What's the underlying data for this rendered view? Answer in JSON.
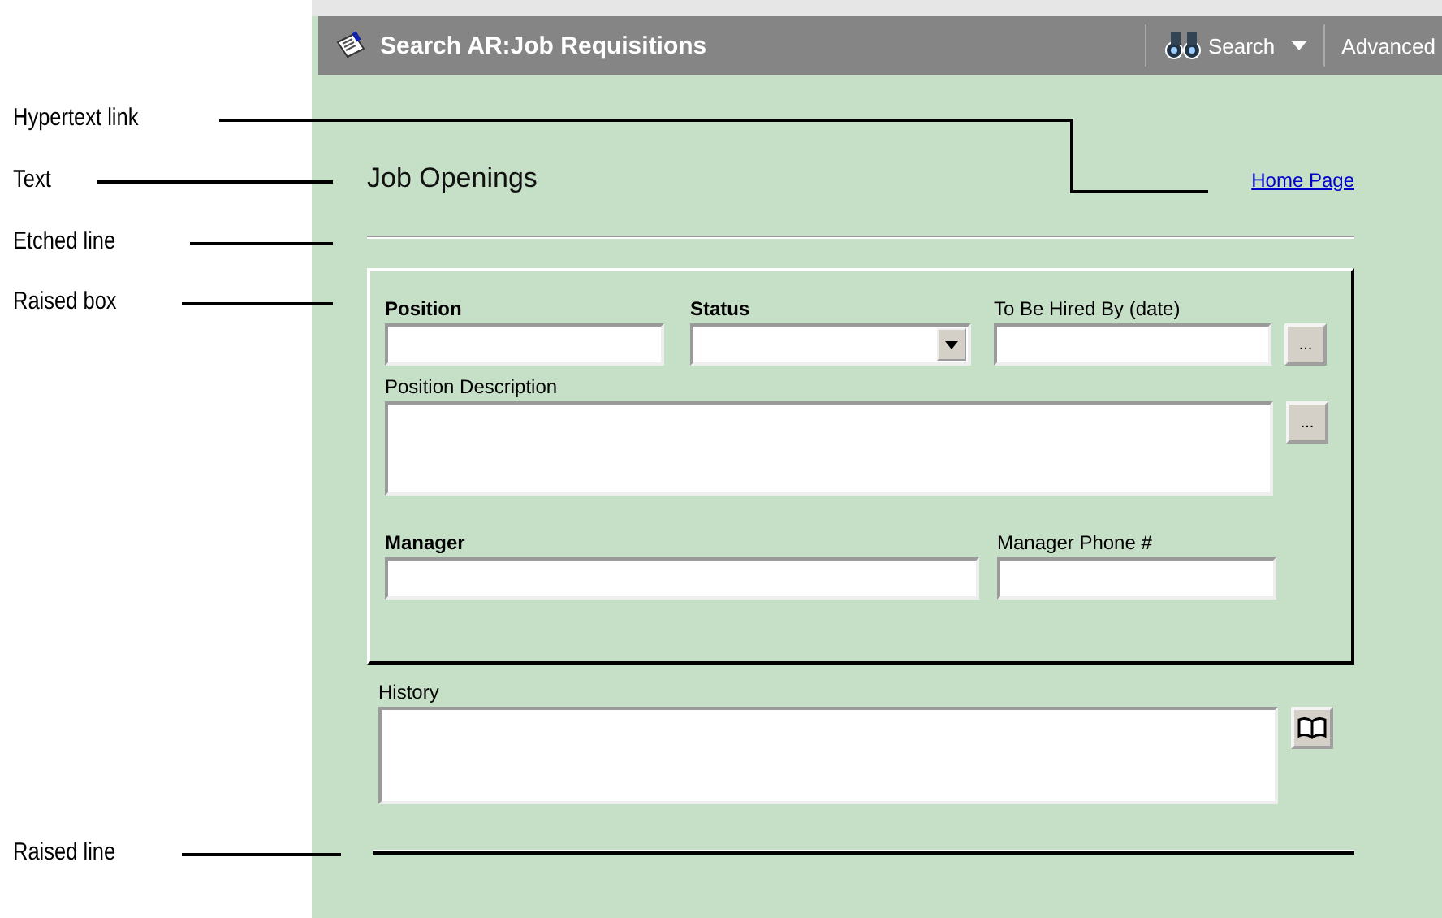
{
  "callouts": [
    {
      "label": "Hypertext link",
      "kind": "elbow"
    },
    {
      "label": "Text",
      "kind": "straight"
    },
    {
      "label": "Etched line",
      "kind": "straight"
    },
    {
      "label": "Raised box",
      "kind": "straight"
    },
    {
      "label": "Raised line",
      "kind": "straight"
    }
  ],
  "window": {
    "title": "Search AR:Job Requisitions"
  },
  "toolbar": [
    {
      "label": "Search",
      "kind": "search"
    },
    {
      "label": "Advanced",
      "kind": "plain"
    }
  ],
  "heading": "Job Openings",
  "link": "Home Page",
  "form": {
    "fields": [
      {
        "label": "Position",
        "bold": true,
        "kind": "text"
      },
      {
        "label": "Status",
        "bold": true,
        "kind": "select"
      },
      {
        "label": "To Be Hired By (date)",
        "bold": false,
        "kind": "text-button",
        "button": "..."
      },
      {
        "label": "Position Description",
        "bold": false,
        "kind": "textarea-button",
        "button": "..."
      },
      {
        "label": "Manager",
        "bold": true,
        "kind": "text"
      },
      {
        "label": "Manager Phone #",
        "bold": false,
        "kind": "text"
      }
    ]
  },
  "history": {
    "label": "History",
    "bold": false
  }
}
